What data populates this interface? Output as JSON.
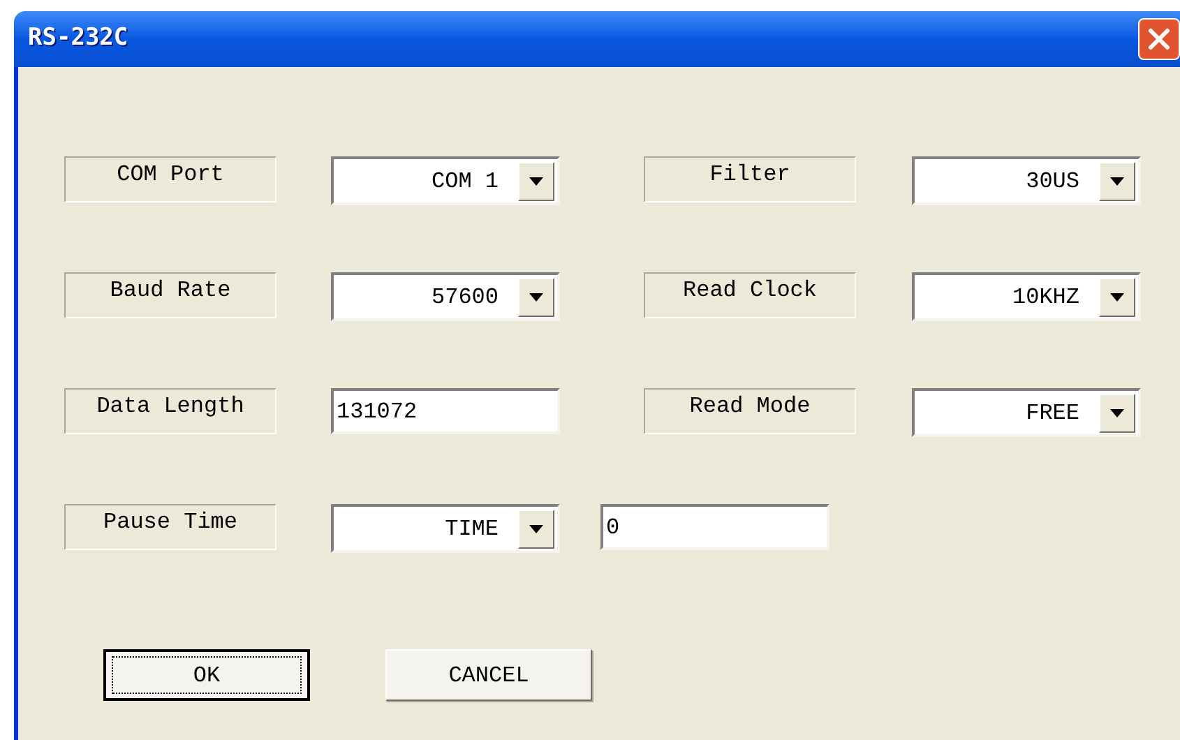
{
  "window": {
    "title": "RS-232C"
  },
  "rows": [
    {
      "left": {
        "label": "COM Port",
        "control": {
          "kind": "dropdown",
          "value": "COM 1"
        }
      },
      "right": {
        "label": "Filter",
        "control": {
          "kind": "dropdown",
          "value": "30US"
        }
      }
    },
    {
      "left": {
        "label": "Baud Rate",
        "control": {
          "kind": "dropdown",
          "value": "57600"
        }
      },
      "right": {
        "label": "Read Clock",
        "control": {
          "kind": "dropdown",
          "value": "10KHZ"
        }
      }
    },
    {
      "left": {
        "label": "Data Length",
        "control": {
          "kind": "text",
          "value": "131072"
        }
      },
      "right": {
        "label": "Read Mode",
        "control": {
          "kind": "dropdown",
          "value": "FREE"
        }
      }
    },
    {
      "left": {
        "label": "Pause Time",
        "control": {
          "kind": "dropdown",
          "value": "TIME"
        }
      },
      "extra": {
        "kind": "text",
        "value": "0"
      }
    }
  ],
  "buttons": [
    {
      "label": "OK",
      "default": true
    },
    {
      "label": "CANCEL",
      "default": false
    }
  ]
}
